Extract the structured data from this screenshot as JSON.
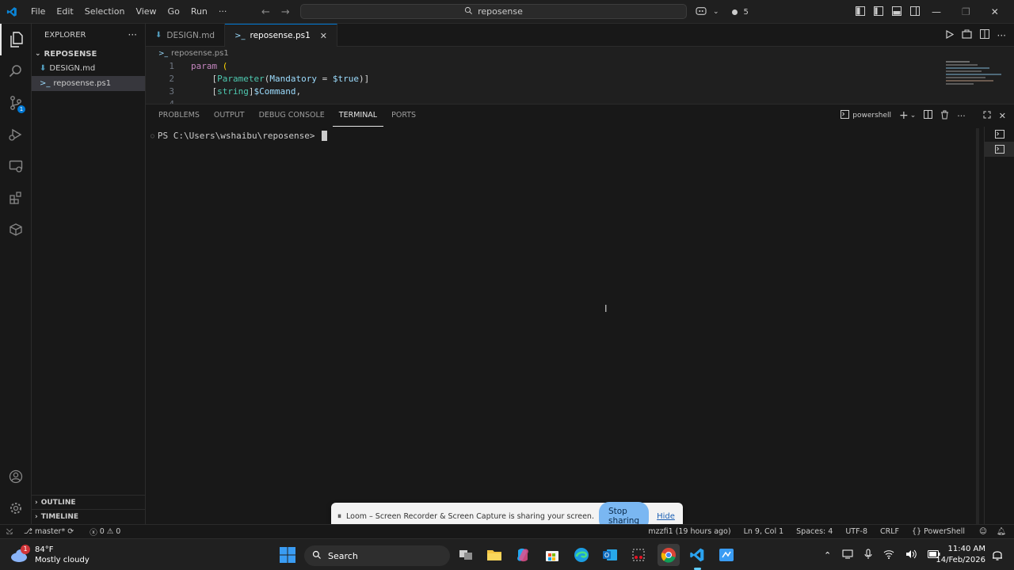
{
  "titlebar": {
    "menus": [
      "File",
      "Edit",
      "Selection",
      "View",
      "Go",
      "Run",
      "···"
    ],
    "search_text": "reposense",
    "copilot_count": "5"
  },
  "sidebar": {
    "title": "EXPLORER",
    "folder": "REPOSENSE",
    "files": [
      {
        "name": "DESIGN.md",
        "icon": "markdown-icon",
        "active": false
      },
      {
        "name": "reposense.ps1",
        "icon": "powershell-icon",
        "active": true
      }
    ],
    "outline": "OUTLINE",
    "timeline": "TIMELINE"
  },
  "tabs": [
    {
      "label": "DESIGN.md",
      "active": false
    },
    {
      "label": "reposense.ps1",
      "active": true
    }
  ],
  "editor": {
    "breadcrumb": "reposense.ps1",
    "line_numbers": [
      "1",
      "2",
      "3",
      "4"
    ]
  },
  "panel": {
    "tabs": [
      "PROBLEMS",
      "OUTPUT",
      "DEBUG CONSOLE",
      "TERMINAL",
      "PORTS"
    ],
    "active_tab": "TERMINAL",
    "shell": "powershell",
    "prompt": "PS C:\\Users\\wshaibu\\reposense> "
  },
  "loom": {
    "message": "Loom – Screen Recorder & Screen Capture is sharing your screen.",
    "stop_label": "Stop sharing",
    "hide_label": "Hide"
  },
  "statusbar": {
    "branch": "master*",
    "errors": "0",
    "warnings": "0",
    "blame": "mzzfi1 (19 hours ago)",
    "position": "Ln 9, Col 1",
    "spaces": "Spaces: 4",
    "encoding": "UTF-8",
    "eol": "CRLF",
    "language": "PowerShell"
  },
  "taskbar": {
    "weather_temp": "84°F",
    "weather_desc": "Mostly cloudy",
    "weather_badge": "1",
    "search_label": "Search",
    "time": "11:40 AM",
    "date": "14/Feb/2026"
  },
  "colors": {
    "accent": "#0078d4",
    "background": "#181818",
    "editor_bg": "#1f1f1f",
    "loom_button": "#7ab7f2"
  }
}
